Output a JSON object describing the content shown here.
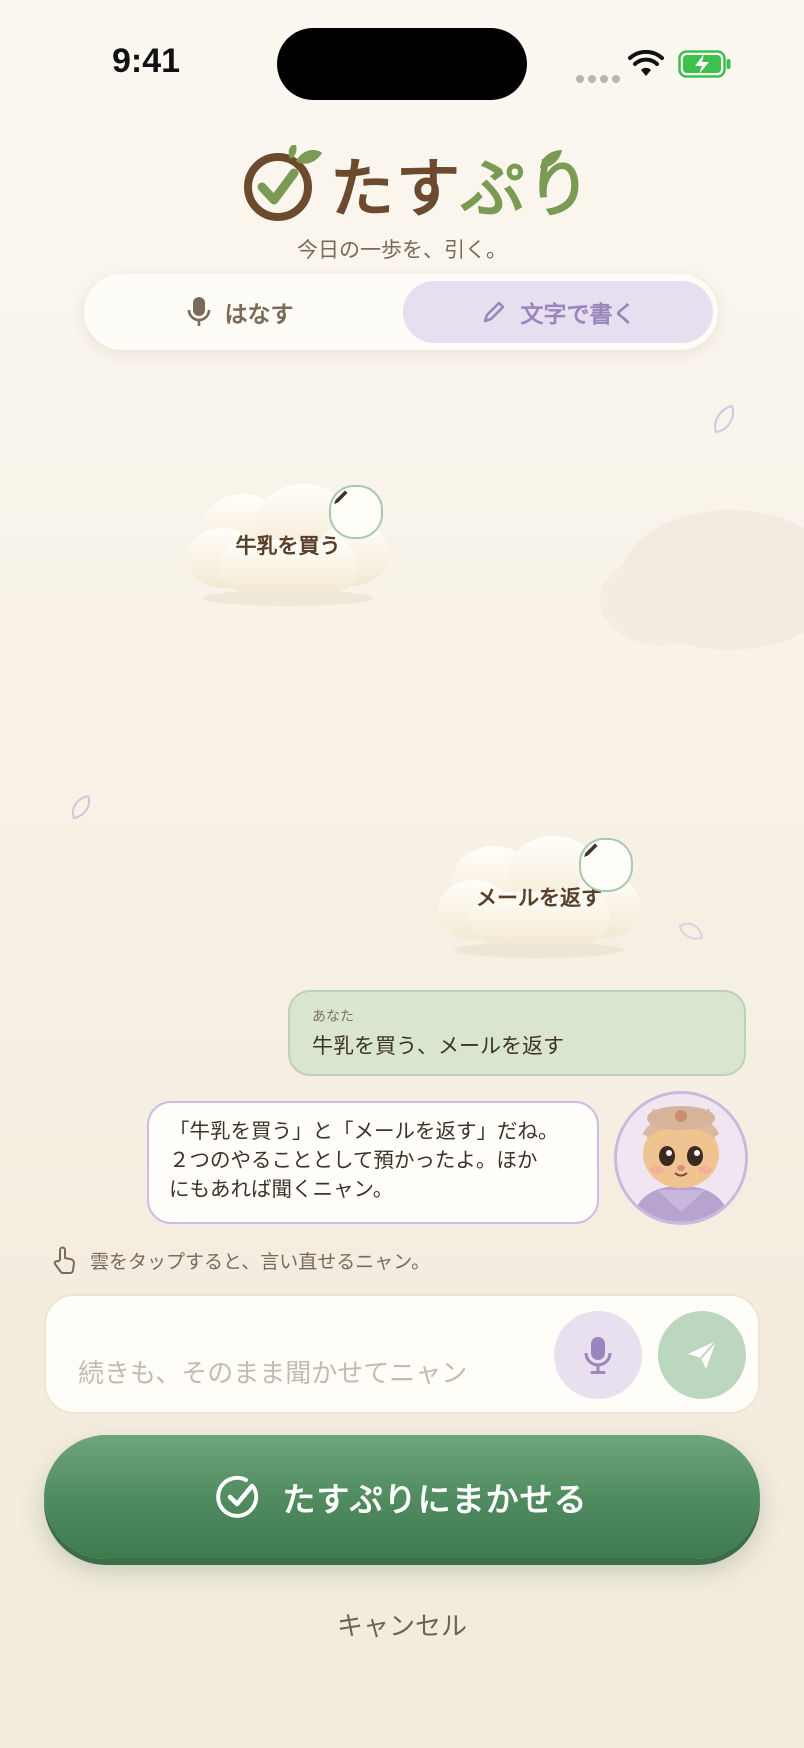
{
  "status_bar": {
    "time": "9:41"
  },
  "app": {
    "logo_prefix": "たす",
    "logo_suffix": "ぷり",
    "tagline": "今日の一歩を、引く。"
  },
  "mode_tabs": [
    {
      "label": "はなす",
      "icon": "microphone-icon",
      "selected": false
    },
    {
      "label": "文字で書く",
      "icon": "pencil-icon",
      "selected": true
    }
  ],
  "clouds": [
    {
      "label": "牛乳を買う"
    },
    {
      "label": "メールを返す"
    }
  ],
  "chat": {
    "user": {
      "name": "あなた",
      "text": "牛乳を買う、メールを返す"
    },
    "assistant": {
      "line1": "「牛乳を買う」と「メールを返す」だね。",
      "line2": "２つのやることとして預かったよ。ほか",
      "line3": "にもあれば聞くニャン。"
    }
  },
  "hint": "雲をタップすると、言い直せるニャン。",
  "input": {
    "value": "",
    "placeholder": "続きも、そのまま聞かせてニャン"
  },
  "primary_button": {
    "label": "たすぷりにまかせる"
  },
  "cancel_label": "キャンセル",
  "colors": {
    "accent_green": "#4e8a5e",
    "accent_purple": "#9a86bd",
    "brown": "#6b4a2e"
  }
}
